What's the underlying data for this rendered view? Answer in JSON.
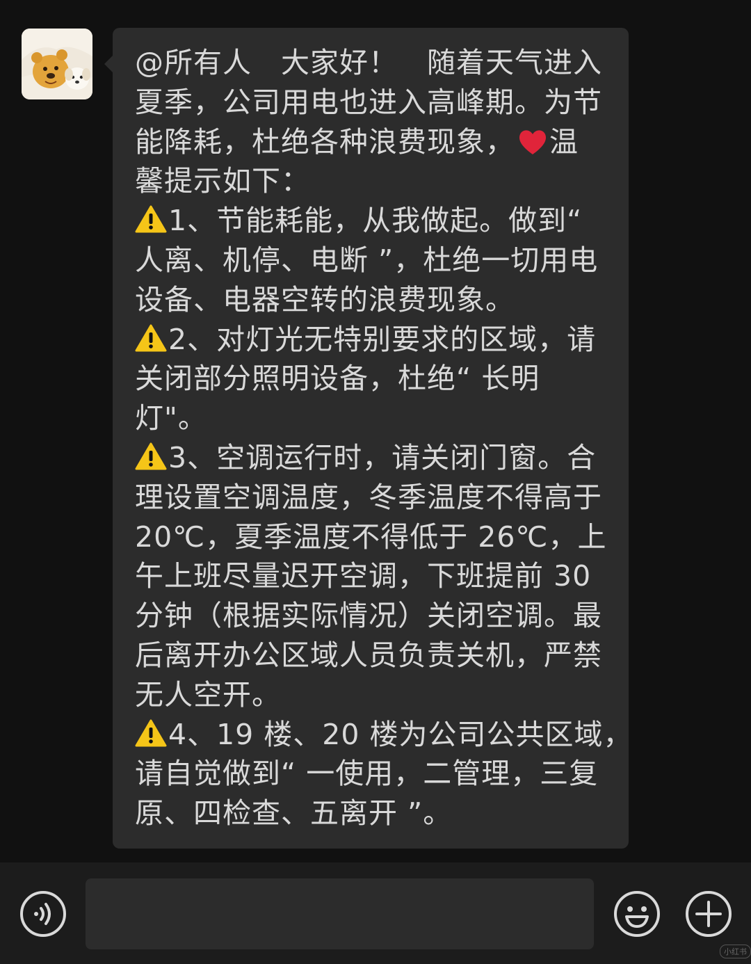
{
  "chat": {
    "avatar_icon": "winnie-the-pooh-and-puppy-avatar",
    "message": {
      "lines": [
        {
          "text": "@所有人　大家好！　随着天气进入"
        },
        {
          "text": "夏季，公司用电也进入高峰期。为节"
        },
        {
          "text": "能降耗，杜绝各种浪费现象，",
          "after_icon": "heart-icon",
          "after_text": "温"
        },
        {
          "text": "馨提示如下："
        },
        {
          "icon": "warning-icon",
          "text": "1、节能耗能，从我做起。做到“"
        },
        {
          "text": "人离、机停、电断 ”，杜绝一切用电"
        },
        {
          "text": "设备、电器空转的浪费现象。"
        },
        {
          "icon": "warning-icon",
          "text": "2、对灯光无特别要求的区域，请"
        },
        {
          "text": "关闭部分照明设备，杜绝“ 长明"
        },
        {
          "text": "灯\"。"
        },
        {
          "icon": "warning-icon",
          "text": "3、空调运行时，请关闭门窗。合"
        },
        {
          "text": "理设置空调温度，冬季温度不得高于"
        },
        {
          "text": "20℃，夏季温度不得低于 26℃，上"
        },
        {
          "text": "午上班尽量迟开空调，下班提前 30"
        },
        {
          "text": "分钟（根据实际情况）关闭空调。最"
        },
        {
          "text": "后离开办公区域人员负责关机，严禁"
        },
        {
          "text": "无人空开。"
        },
        {
          "icon": "warning-icon",
          "text": "4、19 楼、20 楼为公司公共区域，"
        },
        {
          "text": "请自觉做到“ 一使用，二管理，三复"
        },
        {
          "text": "原、四检查、五离开 ”。"
        }
      ]
    }
  },
  "input_bar": {
    "voice_icon": "voice-input-icon",
    "input_value": "",
    "emoji_icon": "emoji-icon",
    "plus_icon": "plus-icon"
  },
  "watermark": "小红书",
  "colors": {
    "background": "#111111",
    "bubble": "#2c2c2c",
    "text": "#d9d9d9",
    "warning": "#f5c518",
    "heart": "#e0243a"
  }
}
